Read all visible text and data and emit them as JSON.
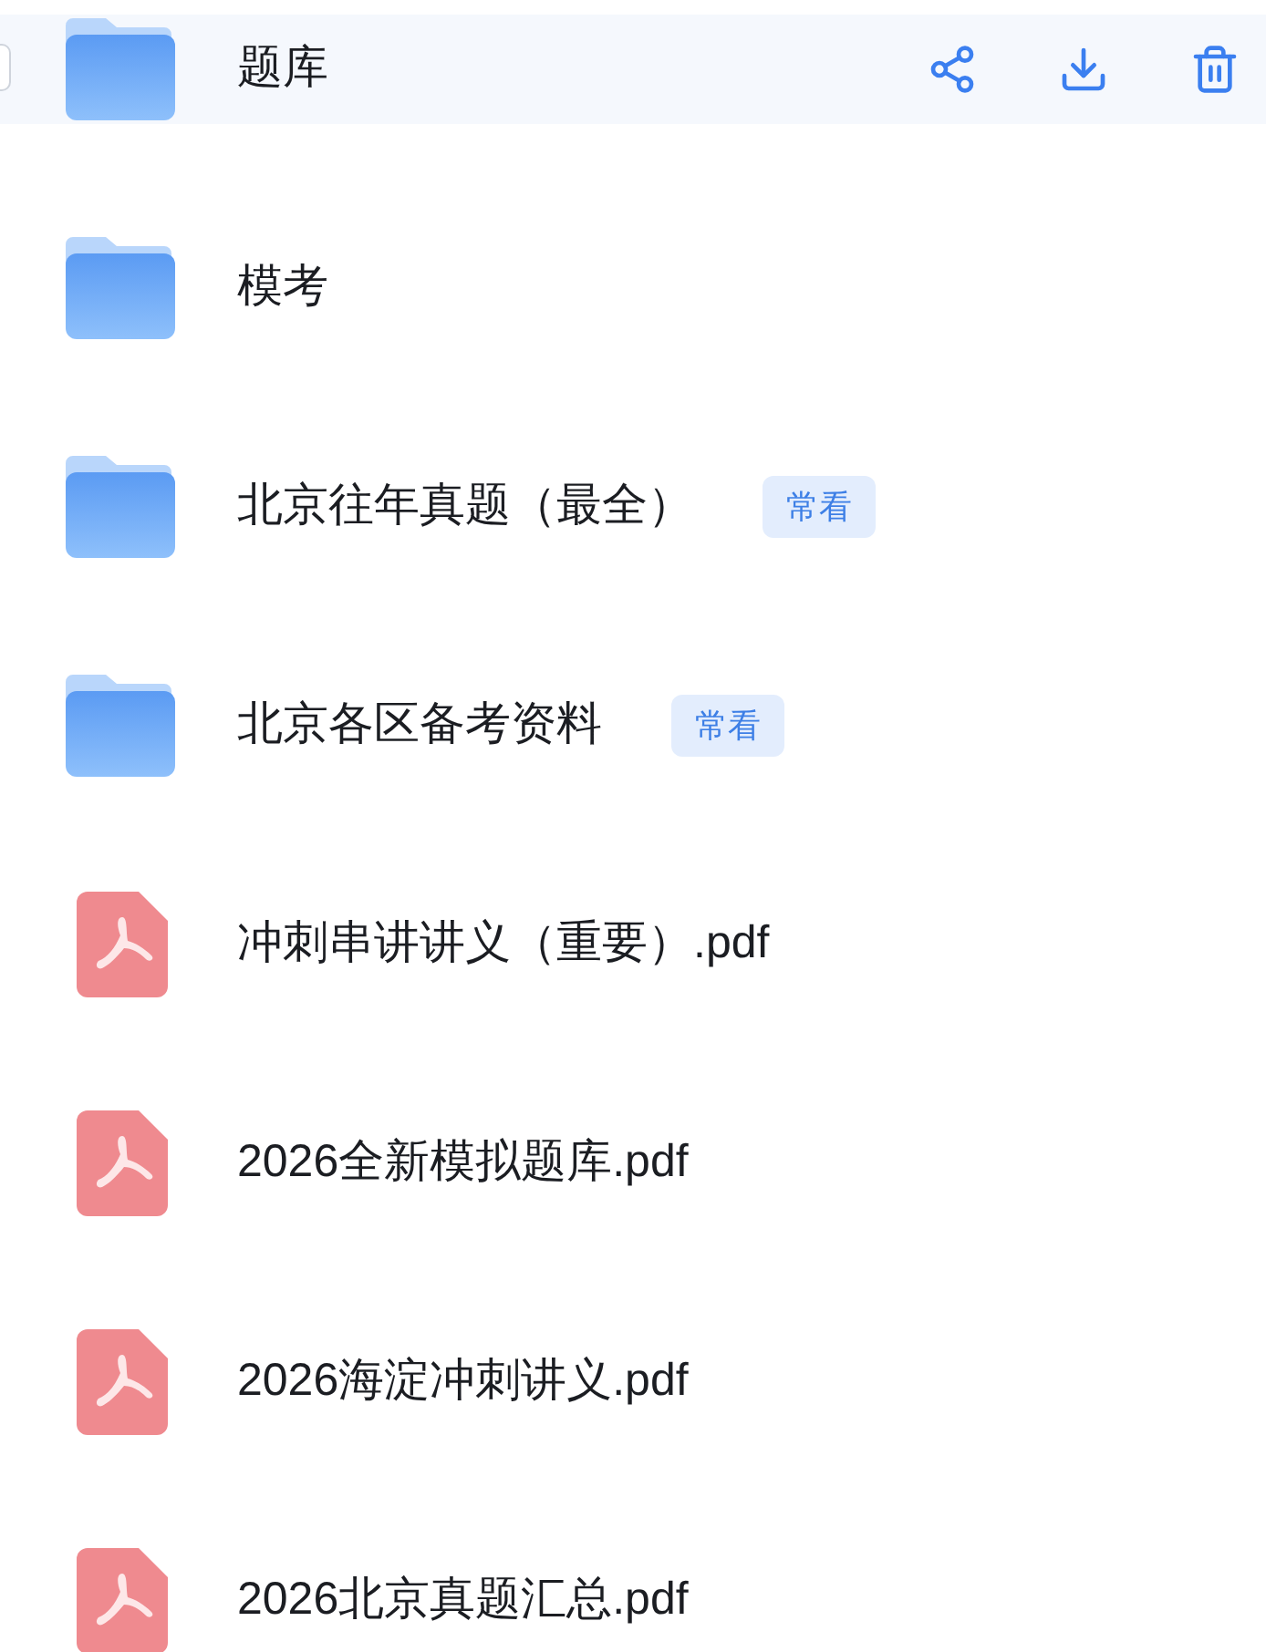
{
  "files": [
    {
      "kind": "folder",
      "name": "题库",
      "selected": true
    },
    {
      "kind": "folder",
      "name": "模考",
      "selected": false
    },
    {
      "kind": "folder",
      "name": "北京往年真题（最全）",
      "tag": "常看",
      "selected": false
    },
    {
      "kind": "folder",
      "name": "北京各区备考资料",
      "tag": "常看",
      "selected": false
    },
    {
      "kind": "pdf",
      "name": "冲刺串讲讲义（重要）.pdf",
      "selected": false
    },
    {
      "kind": "pdf",
      "name": "2026全新模拟题库.pdf",
      "selected": false
    },
    {
      "kind": "pdf",
      "name": "2026海淀冲刺讲义.pdf",
      "selected": false
    },
    {
      "kind": "pdf",
      "name": "2026北京真题汇总.pdf",
      "selected": false
    }
  ]
}
